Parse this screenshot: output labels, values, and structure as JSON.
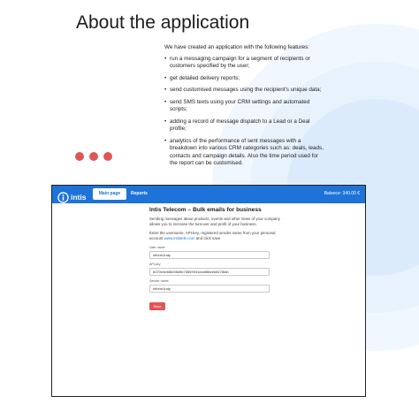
{
  "hero": {
    "title": "About the application",
    "intro": "We have created an application with the following features:",
    "features": [
      "run a messaging campaign for a segment of recipients or customers specified by the user;",
      "get detailed delivery reports;",
      "send customised messages using the recipient's unique data;",
      "send SMS texts using your CRM settings and automated scripts;",
      "adding a record of message dispatch  to a Lead or a Deal profile;",
      "analytics of the performance of sent messages with a breakdown into various CRM categories such as: deals, leads, contacts and campaign details. Also the time period used for the report can be customised."
    ]
  },
  "colors": {
    "accent": "#1e73d8",
    "dot": "#e05656",
    "circle": "#eaf3fd"
  },
  "app": {
    "logo_text": "intis",
    "logo_sub": "TELECOM",
    "tabs": {
      "main": "Main page",
      "reports": "Reports"
    },
    "balance": "Balance: 340.00 €",
    "title": "Intis Telecom – Bulk emails for business",
    "description": "Sending messages about products, events and other news of your company allows you to increase the turnover and profit of your business.",
    "hint_prefix": "Enter the username, API-key, registered sender name from your personal account ",
    "hint_link": "www.intistele.com",
    "hint_suffix": " and click save",
    "fields": {
      "username": {
        "label": "User name",
        "value": "inform1ndy"
      },
      "apikey": {
        "label": "API-key",
        "value": "b070e4e6f8498d9b78559931ea4f88eeb8478fab"
      },
      "sender": {
        "label": "Sender name",
        "value": "inform1ndy"
      }
    },
    "save_label": "Save"
  }
}
